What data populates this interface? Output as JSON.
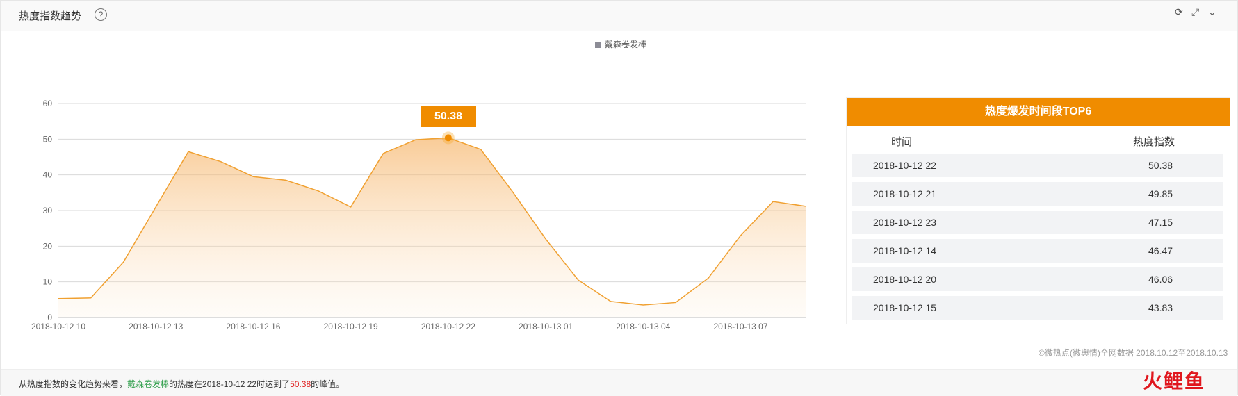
{
  "header": {
    "title": "热度指数趋势",
    "help_icon": "question-circle-icon",
    "icons": [
      "refresh-icon",
      "expand-icon",
      "chevron-down-icon"
    ]
  },
  "legend": {
    "series_name": "戴森卷发棒",
    "color": "#8c8c96"
  },
  "tooltip": {
    "value": "50.38"
  },
  "chart_data": {
    "type": "area",
    "series": [
      {
        "name": "戴森卷发棒",
        "color": "#f0a030",
        "values": [
          5.3,
          5.5,
          15.5,
          31.0,
          46.5,
          43.7,
          39.5,
          38.5,
          35.5,
          31.0,
          46.0,
          49.85,
          50.38,
          47.15,
          35.0,
          22.0,
          10.5,
          4.5,
          3.5,
          4.2,
          11.0,
          23.0,
          32.5,
          31.2
        ]
      }
    ],
    "x": [
      "2018-10-12 10",
      "2018-10-12 11",
      "2018-10-12 12",
      "2018-10-12 13",
      "2018-10-12 14",
      "2018-10-12 15",
      "2018-10-12 16",
      "2018-10-12 17",
      "2018-10-12 18",
      "2018-10-12 19",
      "2018-10-12 20",
      "2018-10-12 21",
      "2018-10-12 22",
      "2018-10-12 23",
      "2018-10-13 00",
      "2018-10-13 01",
      "2018-10-13 02",
      "2018-10-13 03",
      "2018-10-13 04",
      "2018-10-13 05",
      "2018-10-13 06",
      "2018-10-13 07",
      "2018-10-13 08",
      "2018-10-13 09"
    ],
    "x_tick_labels": [
      "2018-10-12 10",
      "2018-10-12 13",
      "2018-10-12 16",
      "2018-10-12 19",
      "2018-10-12 22",
      "2018-10-13 01",
      "2018-10-13 04",
      "2018-10-13 07"
    ],
    "y_ticks": [
      0,
      10,
      20,
      30,
      40,
      50,
      60
    ],
    "ylim": [
      0,
      60
    ],
    "grid": true,
    "legend_position": "top-center",
    "highlight_index": 12
  },
  "top6": {
    "title": "热度爆发时间段TOP6",
    "col_time": "时间",
    "col_value": "热度指数",
    "rows": [
      {
        "time": "2018-10-12 22",
        "value": "50.38"
      },
      {
        "time": "2018-10-12 21",
        "value": "49.85"
      },
      {
        "time": "2018-10-12 23",
        "value": "47.15"
      },
      {
        "time": "2018-10-12 14",
        "value": "46.47"
      },
      {
        "time": "2018-10-12 20",
        "value": "46.06"
      },
      {
        "time": "2018-10-12 15",
        "value": "43.83"
      }
    ]
  },
  "copyright": "©微热点(微舆情)全网数据 2018.10.12至2018.10.13",
  "footer": {
    "p1": "从热度指数的变化趋势来看，",
    "brand": "戴森卷发棒",
    "p2": "的热度在2018-10-12 22时达到了",
    "peak": "50.38",
    "p3": "的峰值。"
  },
  "watermark": "火鲤鱼",
  "colors": {
    "accent": "#f08c00",
    "brand_green": "#2e9e4a",
    "peak_red": "#e02020"
  }
}
